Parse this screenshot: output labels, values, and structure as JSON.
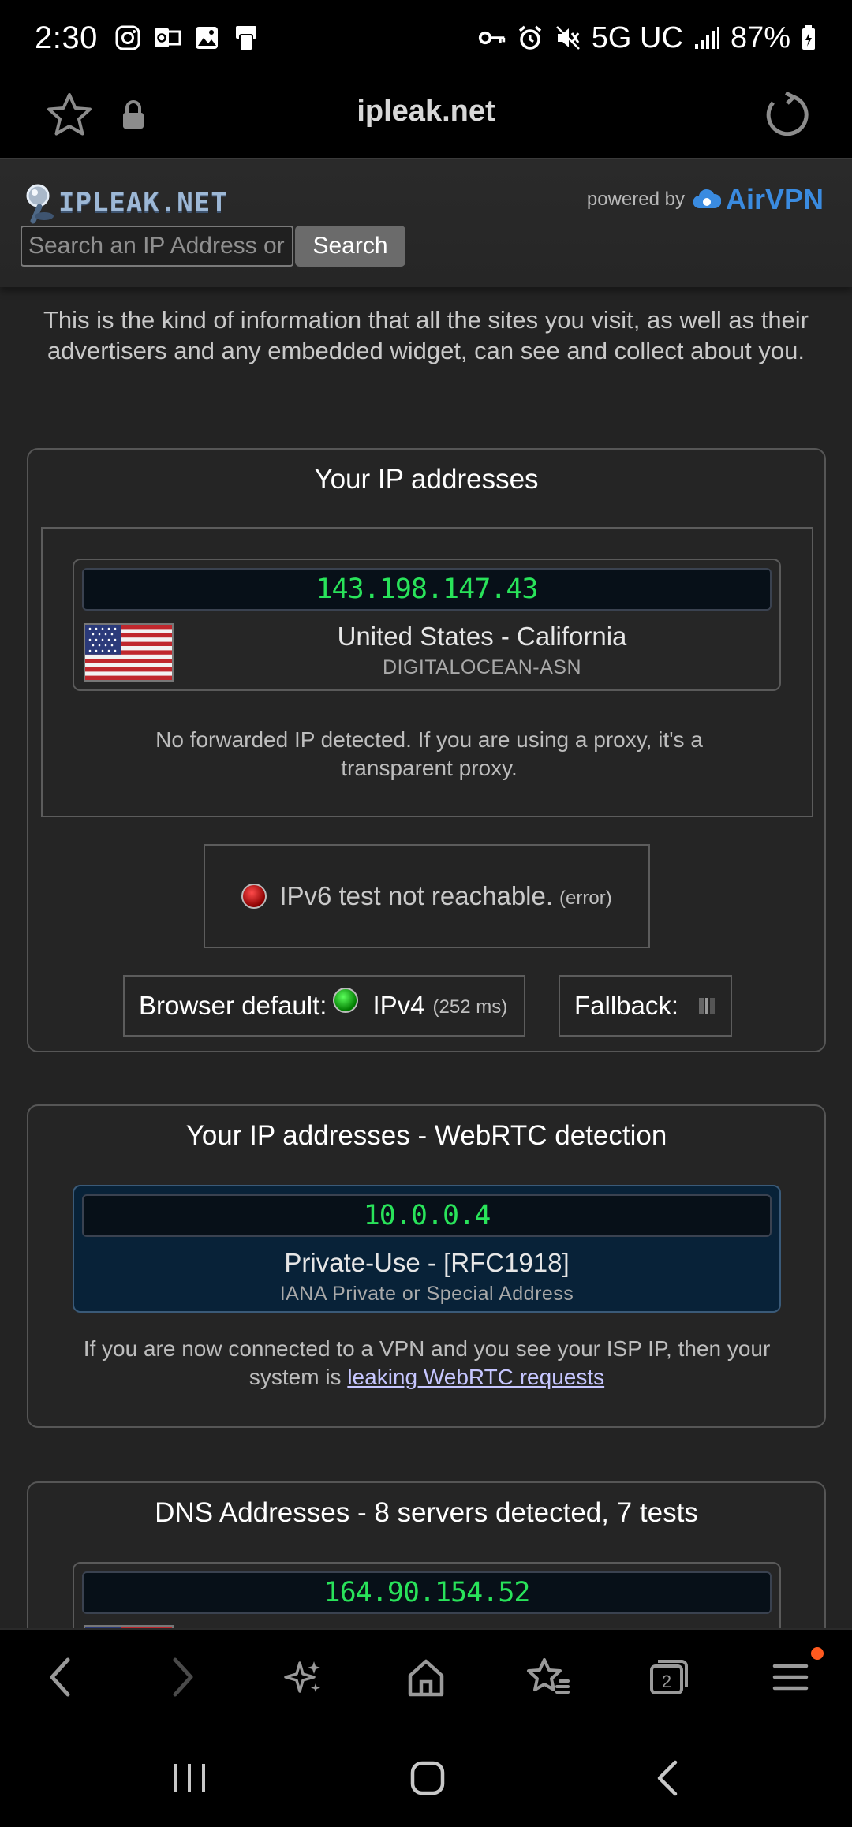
{
  "status_bar": {
    "time": "2:30",
    "network": "5G UC",
    "battery": "87%"
  },
  "browser": {
    "url": "ipleak.net"
  },
  "header": {
    "logo_text": "IPLEAK.NET",
    "powered_by_label": "powered by",
    "sponsor_name": "AirVPN",
    "search_placeholder": "Search an IP Address or domain",
    "search_button": "Search"
  },
  "intro_text": "This is the kind of information that all the sites you visit, as well as their advertisers and any embedded widget, can see and collect about you.",
  "ip_panel": {
    "title": "Your IP addresses",
    "ip": "143.198.147.43",
    "location": "United States - California",
    "asn": "DIGITALOCEAN-ASN",
    "forwarded_note": "No forwarded IP detected. If you are using a proxy, it's a transparent proxy.",
    "ipv6_text": "IPv6 test not reachable.",
    "ipv6_status": "(error)",
    "browser_default_label": "Browser default:",
    "browser_default_proto": "IPv4",
    "browser_default_time": "(252 ms)",
    "fallback_label": "Fallback:"
  },
  "webrtc_panel": {
    "title": "Your IP addresses - WebRTC detection",
    "ip": "10.0.0.4",
    "range": "Private-Use - [RFC1918]",
    "range_sub": "IANA Private or Special Address",
    "note_prefix": "If you are now connected to a VPN and you see your ISP IP, then your system is ",
    "note_link": "leaking WebRTC requests"
  },
  "dns_panel": {
    "title": "DNS Addresses - 8 servers detected, 7 tests",
    "first_ip": "164.90.154.52"
  },
  "colors": {
    "ip_green": "#29e35a",
    "accent_blue": "#3a8be0",
    "notification_dot": "#ff5a1f"
  }
}
